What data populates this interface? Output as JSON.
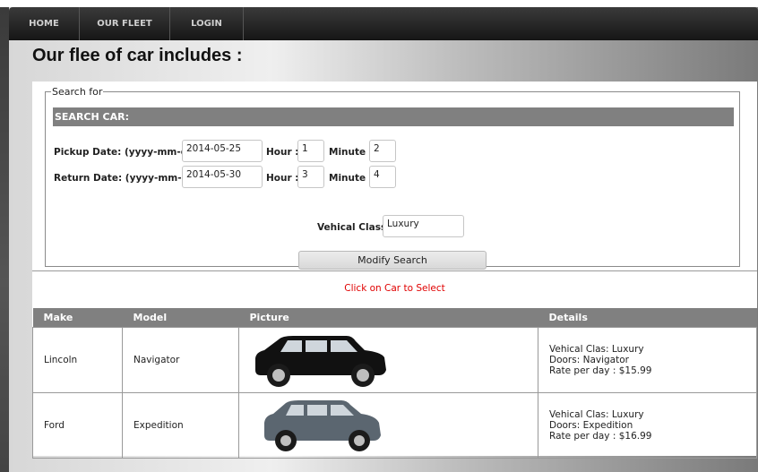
{
  "nav": {
    "items": [
      {
        "label": "HOME"
      },
      {
        "label": "OUR FLEET"
      },
      {
        "label": "LOGIN"
      }
    ]
  },
  "page": {
    "title": "Our flee of car includes :"
  },
  "search": {
    "legend": "Search for",
    "header": "SEARCH CAR:",
    "pickup": {
      "label": "Pickup Date: (yyyy-mm-dd)",
      "date": "2014-05-25",
      "hour_label": "Hour :",
      "hour": "1",
      "minute_label": "Minute :",
      "minute": "2"
    },
    "return": {
      "label": "Return Date: (yyyy-mm-dd)",
      "date": "2014-05-30",
      "hour_label": "Hour :",
      "hour": "3",
      "minute_label": "Minute :",
      "minute": "4"
    },
    "vehicle_class_label": "Vehical Class:",
    "vehicle_class": "Luxury",
    "modify_label": "Modify Search"
  },
  "results": {
    "hint": "Click on Car to Select",
    "columns": [
      "Make",
      "Model",
      "Picture",
      "Details"
    ],
    "rows": [
      {
        "make": "Lincoln",
        "model": "Navigator",
        "car_color": "#111111",
        "details": [
          "Vehical Clas: Luxury",
          "Doors: Navigator",
          "Rate per day : $15.99"
        ]
      },
      {
        "make": "Ford",
        "model": "Expedition",
        "car_color": "#5b6670",
        "details": [
          "Vehical Clas: Luxury",
          "Doors: Expedition",
          "Rate per day : $16.99"
        ]
      }
    ]
  }
}
